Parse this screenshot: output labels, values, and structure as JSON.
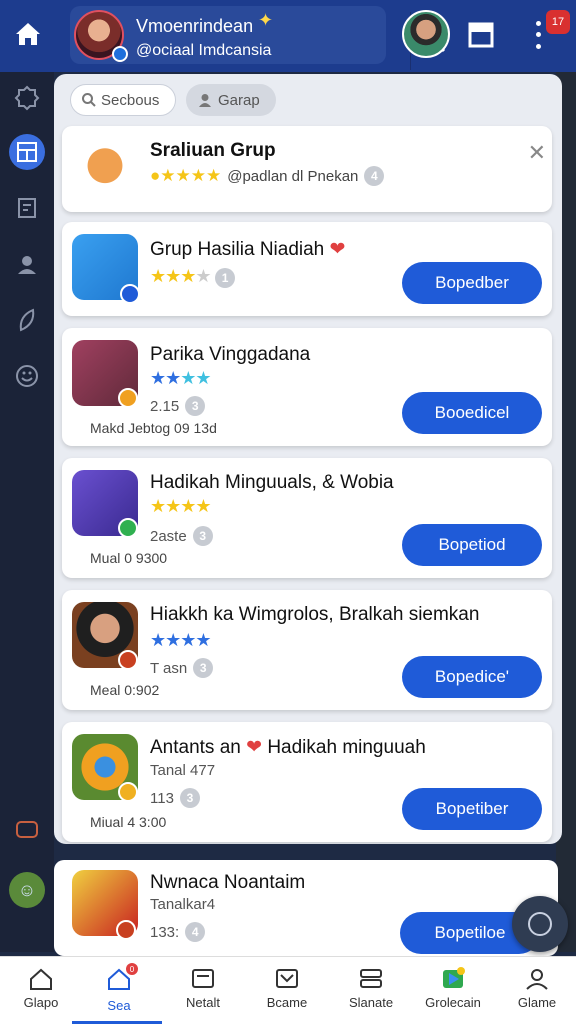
{
  "topbar": {
    "profile_name": "Vmoenrindean",
    "profile_handle": "@ociaal Imdcansia",
    "notif_count": "17"
  },
  "panel": {
    "search_label": "Secbous",
    "group_label": "Garap",
    "cards": [
      {
        "title": "Sraliuan Grup",
        "meta": "@padlan dl Pnekan",
        "badge": "4"
      },
      {
        "title": "Grup Hasilia Niadiah",
        "badge": "1",
        "button": "Bopedber"
      },
      {
        "title": "Parika Vinggadana",
        "meta": "2.15",
        "badge": "3",
        "footer": "Makd Jebtog 09 13d",
        "button": "Booedicel"
      },
      {
        "title": "Hadikah Minguuals, & Wobia",
        "meta": "2aste",
        "badge": "3",
        "footer": "Mual 0 9300",
        "button": "Bopetiod"
      },
      {
        "title": "Hiakkh ka Wimgrolos, Bralkah siemkan",
        "meta": "T asn",
        "badge": "3",
        "footer": "Meal 0:902",
        "button": "Bopedice'"
      },
      {
        "title": "Antants an",
        "title_b": "Hadikah minguuah",
        "sub": "Tanal 477",
        "meta": "113",
        "badge": "3",
        "footer": "Miual 4 3:00",
        "button": "Bopetiber"
      }
    ],
    "lower_card": {
      "title": "Nwnaca Noantaim",
      "sub": "Tanalkar4",
      "meta": "133:",
      "badge": "4",
      "button": "Bopetiloe"
    }
  },
  "bottom_nav": [
    {
      "label": "Glapo"
    },
    {
      "label": "Sea",
      "badge": "0"
    },
    {
      "label": "Netalt"
    },
    {
      "label": "Bcame"
    },
    {
      "label": "Slanate"
    },
    {
      "label": "Grolecain"
    },
    {
      "label": "Glame"
    }
  ],
  "colors": {
    "topbar": "#1d3c8e",
    "accent": "#1f5bd8",
    "star": "#f5c518",
    "star_blue": "#2f6fe0"
  }
}
